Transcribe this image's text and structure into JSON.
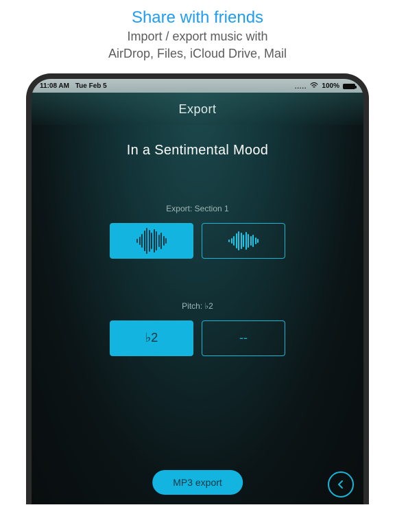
{
  "promo": {
    "title": "Share with friends",
    "line1": "Import / export music with",
    "line2": "AirDrop, Files, iCloud Drive, Mail"
  },
  "status": {
    "time": "11:08 AM",
    "date": "Tue Feb 5",
    "signal": ".....",
    "wifi_icon": "wifi",
    "battery_pct": "100%"
  },
  "nav": {
    "title": "Export"
  },
  "song": {
    "title": "In a Sentimental Mood"
  },
  "export_section": {
    "label": "Export: Section 1"
  },
  "pitch": {
    "label": "Pitch: ♭2",
    "option_a": "♭2",
    "option_b": "--"
  },
  "actions": {
    "export_button": "MP3 export"
  },
  "colors": {
    "accent": "#14b4e0",
    "border": "#15b6d8",
    "bg_dark": "#0b1416"
  }
}
